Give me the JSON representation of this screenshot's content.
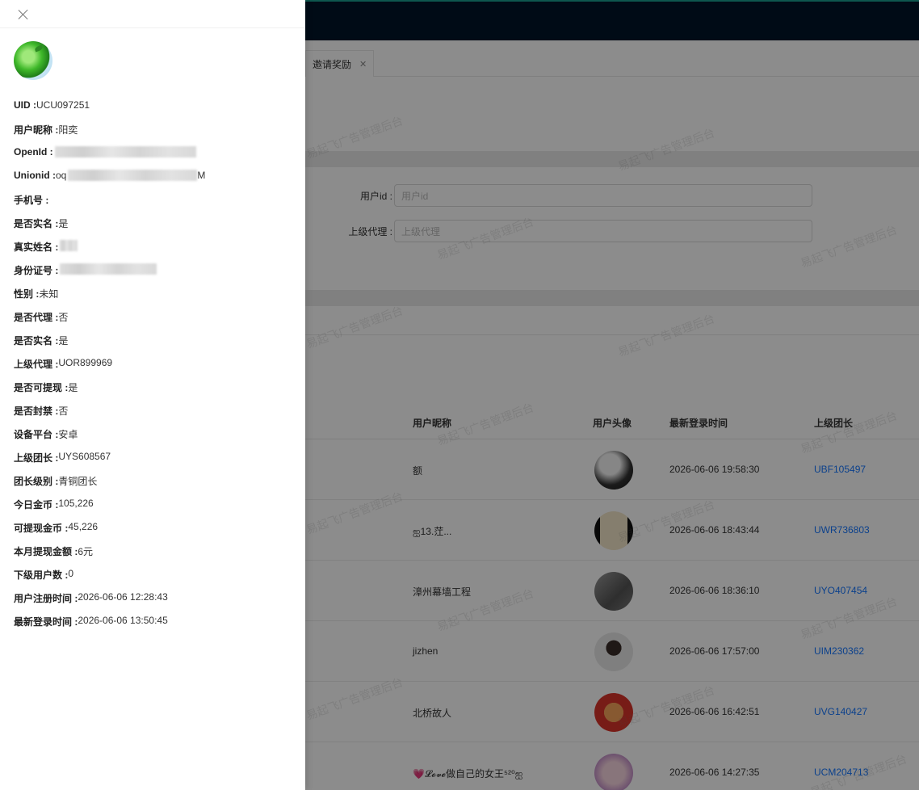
{
  "tabs": [
    {
      "label": "邀请奖励"
    }
  ],
  "filters": [
    {
      "label": "用户id :",
      "placeholder": "用户id"
    },
    {
      "label": "上级代理 :",
      "placeholder": "上级代理"
    }
  ],
  "watermark_text": "易起飞广告管理后台",
  "table": {
    "columns": [
      "用户昵称",
      "用户头像",
      "最新登录时间",
      "上级团长"
    ],
    "rows": [
      {
        "nickname": "额",
        "login_time": "2026-06-06 19:58:30",
        "leader": "UBF105497"
      },
      {
        "nickname": "ஐ13.茳...",
        "login_time": "2026-06-06 18:43:44",
        "leader": "UWR736803"
      },
      {
        "nickname": "漳州幕墙工程",
        "login_time": "2026-06-06 18:36:10",
        "leader": "UYO407454"
      },
      {
        "nickname": "jizhen",
        "login_time": "2026-06-06 17:57:00",
        "leader": "UIM230362"
      },
      {
        "nickname": "北桥故人",
        "login_time": "2026-06-06 16:42:51",
        "leader": "UVG140427"
      },
      {
        "nickname": "💗𝓛𝓸𝓿𝓮做自己的女王⁵²⁰ஐ",
        "login_time": "2026-06-06 14:27:35",
        "leader": "UCM204713"
      }
    ]
  },
  "drawer": {
    "fields": [
      {
        "label": "UID : ",
        "value": "UCU097251"
      },
      {
        "label": "用户昵称 : ",
        "value": "阳奕"
      },
      {
        "label": "OpenId : ",
        "value": "",
        "blurred": true,
        "blur_width": 175
      },
      {
        "label": "Unionid : ",
        "value": "oq",
        "blurred": true,
        "blur_width": 160,
        "suffix": "M"
      },
      {
        "label": "手机号 : ",
        "value": ""
      },
      {
        "label": "是否实名 : ",
        "value": "是"
      },
      {
        "label": "真实姓名 : ",
        "value": "",
        "blurred": true,
        "blur_width": 22
      },
      {
        "label": "身份证号 : ",
        "value": "",
        "blurred": true,
        "blur_width": 120
      },
      {
        "label": "性别 : ",
        "value": "未知"
      },
      {
        "label": "是否代理 : ",
        "value": "否"
      },
      {
        "label": "是否实名 : ",
        "value": "是"
      },
      {
        "label": "上级代理 : ",
        "value": "UOR899969"
      },
      {
        "label": "是否可提现 : ",
        "value": "是"
      },
      {
        "label": "是否封禁 : ",
        "value": "否"
      },
      {
        "label": "设备平台 : ",
        "value": "安卓"
      },
      {
        "label": "上级团长 : ",
        "value": "UYS608567"
      },
      {
        "label": "团长级别 : ",
        "value": "青铜团长"
      },
      {
        "label": "今日金币 : ",
        "value": "105,226"
      },
      {
        "label": "可提现金币 : ",
        "value": "45,226"
      },
      {
        "label": "本月提现金额 : ",
        "value": "6元"
      },
      {
        "label": "下级用户数 : ",
        "value": "0"
      },
      {
        "label": "用户注册时间 : ",
        "value": "2026-06-06 12:28:43"
      },
      {
        "label": "最新登录时间 : ",
        "value": "2026-06-06 13:50:45"
      }
    ]
  }
}
